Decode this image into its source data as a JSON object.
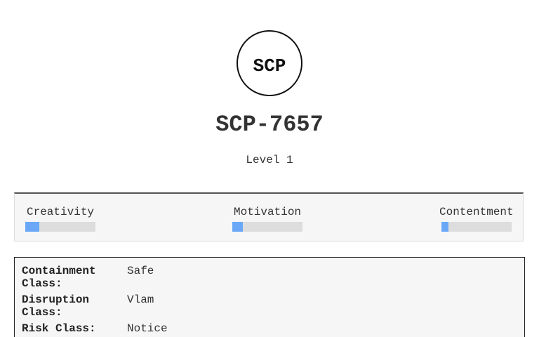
{
  "header": {
    "logo_text": "SCP",
    "title": "SCP-7657",
    "level": "Level 1"
  },
  "stats": [
    {
      "label": "Creativity",
      "value": 0.2
    },
    {
      "label": "Motivation",
      "value": 0.15
    },
    {
      "label": "Contentment",
      "value": 0.1
    }
  ],
  "classes": [
    {
      "key": "Containment Class:",
      "value": "Safe"
    },
    {
      "key": "Disruption Class:",
      "value": "Vlam"
    },
    {
      "key": "Risk Class:",
      "value": "Notice"
    }
  ],
  "colors": {
    "bar_fill": "#6aa8f7",
    "bar_track": "#dddddd",
    "panel_bg": "#f6f6f6"
  }
}
